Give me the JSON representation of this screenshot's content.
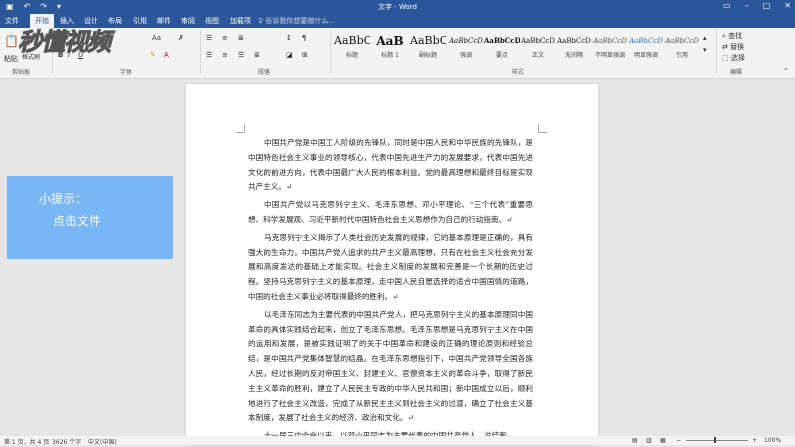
{
  "window": {
    "title": "文字 - Word"
  },
  "tabs": [
    "文件",
    "开始",
    "插入",
    "设计",
    "布局",
    "引用",
    "邮件",
    "审阅",
    "视图",
    "加载项"
  ],
  "tell_me": "告诉我你想要做什么...",
  "ribbon": {
    "font_size": "Aa",
    "paste": "粘贴",
    "format_painter": "格式刷",
    "bold": "B",
    "italic": "I",
    "underline": "U",
    "styles": [
      {
        "sample": "AaBbC",
        "name": "标题"
      },
      {
        "sample": "AaB",
        "name": "标题 1"
      },
      {
        "sample": "AaBbC",
        "name": "副标题"
      },
      {
        "sample": "AaBbCcD",
        "name": "强调"
      },
      {
        "sample": "AaBbCcD",
        "name": "要点"
      },
      {
        "sample": "AaBbCcD",
        "name": "正文"
      },
      {
        "sample": "AaBbCcD",
        "name": "无间隔"
      },
      {
        "sample": "AaBbCcD",
        "name": "不明显强调"
      },
      {
        "sample": "AaBbCcD",
        "name": "明显强调"
      },
      {
        "sample": "AaBbCcD",
        "name": "引用"
      }
    ],
    "find": "查找",
    "replace": "替换",
    "select": "选择",
    "groups": {
      "clipboard": "剪贴板",
      "font": "字体",
      "paragraph": "段落",
      "styles": "样式",
      "editing": "编辑"
    }
  },
  "watermark": "秒懂视频",
  "tip": {
    "line1": "小提示：",
    "line2": "点击文件"
  },
  "document": {
    "paragraphs": [
      "中国共产党是中国工人阶级的先锋队，同时是中国人民和中华民族的先锋队，是中国特色社会主义事业的领导核心，代表中国先进生产力的发展要求，代表中国先进文化的前进方向，代表中国最广大人民的根本利益。党的最高理想和最终目标是实现共产主义。↵",
      "中国共产党以马克思列宁主义、毛泽东思想、邓小平理论、“三个代表”重要思想、科学发展观、习近平新时代中国特色社会主义思想作为自己的行动指南。↵",
      "马克思列宁主义揭示了人类社会历史发展的规律，它的基本原理是正确的，具有强大的生命力。中国共产党人追求的共产主义最高理想，只有在社会主义社会充分发展和高度发达的基础上才能实现。社会主义制度的发展和完善是一个长期的历史过程。坚持马克思列宁主义的基本原理，走中国人民自愿选择的适合中国国情的道路，中国的社会主义事业必将取得最终的胜利。↵",
      "以毛泽东同志为主要代表的中国共产党人，把马克思列宁主义的基本原理同中国革命的具体实践结合起来，创立了毛泽东思想。毛泽东思想是马克思列宁主义在中国的运用和发展，是被实践证明了的关于中国革命和建设的正确的理论原则和经验总结，是中国共产党集体智慧的结晶。在毛泽东思想指引下，中国共产党领导全国各族人民，经过长期的反对帝国主义、封建主义、官僚资本主义的革命斗争，取得了新民主主义革命的胜利，建立了人民民主专政的中华人民共和国；新中国成立以后，顺利地进行了社会主义改造，完成了从新民主主义到社会主义的过渡，确立了社会主义基本制度，发展了社会主义的经济、政治和文化。↵",
      "十一届三中全会以来，以邓小平同志为主要代表的中国共产党人，总结新"
    ]
  },
  "status": {
    "page": "第 1 页，共 4 页",
    "words": "3626 个字",
    "lang": "中文(中国)",
    "zoom": "100%"
  }
}
